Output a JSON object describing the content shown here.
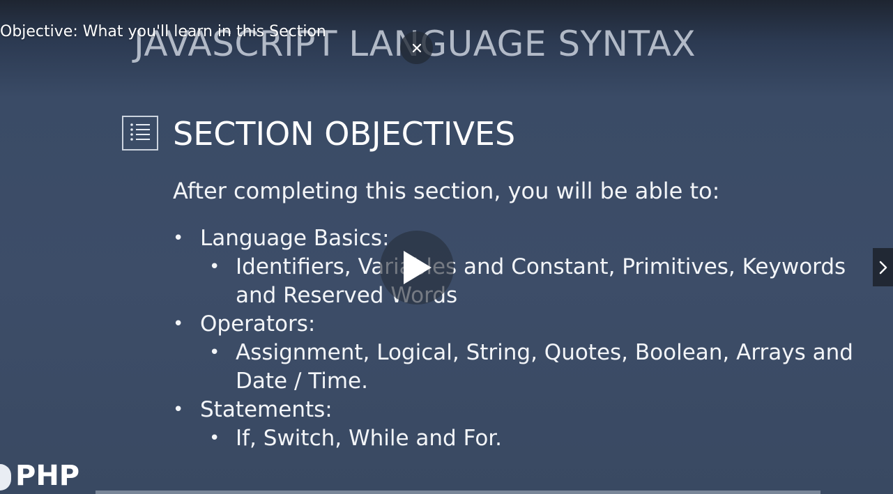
{
  "video": {
    "title": "Objective: What you'll learn in this Section"
  },
  "slide": {
    "heading": "JAVASCRIPT LANGUAGE SYNTAX",
    "section_title": "SECTION OBJECTIVES",
    "intro": "After completing this section, you will be able to:",
    "objectives": [
      {
        "label": "Language Basics:",
        "sub": "Identifiers, Variables and Constant, Primitives, Keywords and Reserved Words"
      },
      {
        "label": "Operators:",
        "sub": "Assignment, Logical, String, Quotes, Boolean, Arrays and Date / Time."
      },
      {
        "label": "Statements:",
        "sub": "If, Switch, While and For."
      }
    ],
    "logo_text": "PHP"
  },
  "controls": {
    "close_icon": "close-icon",
    "play_icon": "play-icon",
    "next_icon": "chevron-right-icon"
  },
  "colors": {
    "background": "#3d4d68",
    "text": "#f3f5f8",
    "overlay": "#262e3c"
  }
}
